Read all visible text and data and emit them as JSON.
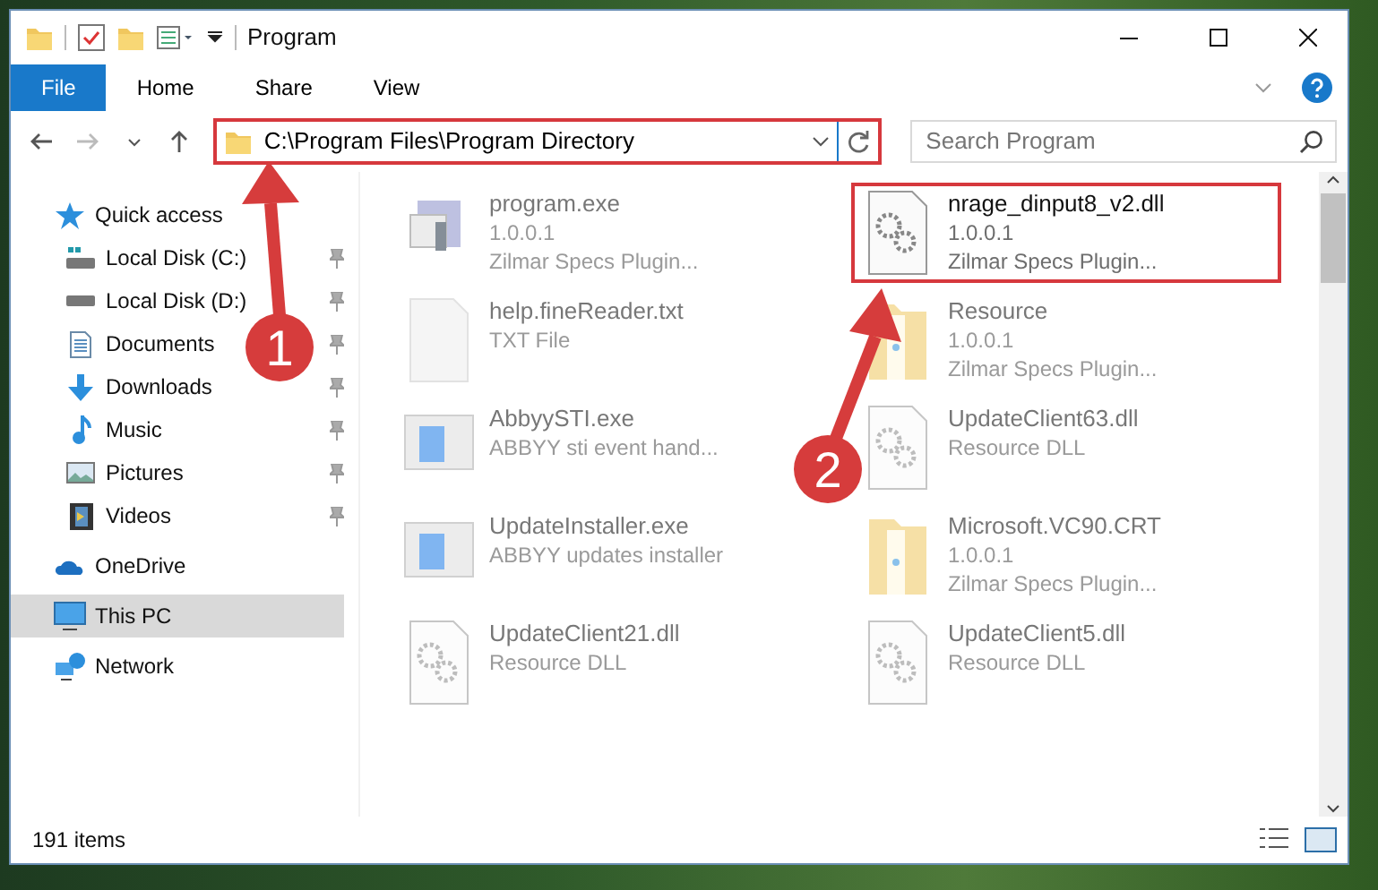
{
  "window": {
    "title": "Program"
  },
  "ribbon_tabs": [
    {
      "label": "File",
      "selected": true
    },
    {
      "label": "Home",
      "selected": false
    },
    {
      "label": "Share",
      "selected": false
    },
    {
      "label": "View",
      "selected": false
    }
  ],
  "address": {
    "value": "C:\\Program Files\\Program Directory",
    "highlighted": true
  },
  "search": {
    "placeholder": "Search Program"
  },
  "nav": [
    {
      "label": "Quick access",
      "kind": "group",
      "pinned": false,
      "selected": false
    },
    {
      "label": "Local Disk (C:)",
      "kind": "item",
      "pinned": true,
      "selected": false
    },
    {
      "label": "Local Disk (D:)",
      "kind": "item",
      "pinned": true,
      "selected": false
    },
    {
      "label": "Documents",
      "kind": "item",
      "pinned": true,
      "selected": false
    },
    {
      "label": "Downloads",
      "kind": "item",
      "pinned": true,
      "selected": false
    },
    {
      "label": "Music",
      "kind": "item",
      "pinned": true,
      "selected": false
    },
    {
      "label": "Pictures",
      "kind": "item",
      "pinned": true,
      "selected": false
    },
    {
      "label": "Videos",
      "kind": "item",
      "pinned": true,
      "selected": false
    },
    {
      "label": "OneDrive",
      "kind": "group",
      "pinned": false,
      "selected": false
    },
    {
      "label": "This PC",
      "kind": "group",
      "pinned": false,
      "selected": true
    },
    {
      "label": "Network",
      "kind": "group",
      "pinned": false,
      "selected": false
    }
  ],
  "files": [
    {
      "name": "program.exe",
      "kind": "exe",
      "blurred": true,
      "highlighted": false,
      "details": [
        "1.0.0.1",
        "Zilmar Specs Plugin..."
      ]
    },
    {
      "name": "nrage_dinput8_v2.dll",
      "kind": "dll",
      "blurred": false,
      "highlighted": true,
      "details": [
        "1.0.0.1",
        "Zilmar Specs Plugin..."
      ]
    },
    {
      "name": "help.fineReader.txt",
      "kind": "txt",
      "blurred": true,
      "highlighted": false,
      "details": [
        "TXT File"
      ]
    },
    {
      "name": "Resource",
      "kind": "folder",
      "blurred": true,
      "highlighted": false,
      "details": [
        "1.0.0.1",
        "Zilmar Specs Plugin..."
      ]
    },
    {
      "name": "AbbyySTI.exe",
      "kind": "app",
      "blurred": true,
      "highlighted": false,
      "details": [
        "ABBYY sti event hand..."
      ]
    },
    {
      "name": "UpdateClient63.dll",
      "kind": "dll",
      "blurred": true,
      "highlighted": false,
      "details": [
        "Resource DLL"
      ]
    },
    {
      "name": "UpdateInstaller.exe",
      "kind": "app",
      "blurred": true,
      "highlighted": false,
      "details": [
        "ABBYY updates installer"
      ]
    },
    {
      "name": "Microsoft.VC90.CRT",
      "kind": "folder",
      "blurred": true,
      "highlighted": false,
      "details": [
        "1.0.0.1",
        "Zilmar Specs Plugin..."
      ]
    },
    {
      "name": "UpdateClient21.dll",
      "kind": "dll",
      "blurred": true,
      "highlighted": false,
      "details": [
        "Resource DLL"
      ]
    },
    {
      "name": "UpdateClient5.dll",
      "kind": "dll",
      "blurred": true,
      "highlighted": false,
      "details": [
        "Resource DLL"
      ]
    }
  ],
  "status_bar": {
    "item_count": "191 items"
  },
  "callouts": [
    {
      "number": "1"
    },
    {
      "number": "2"
    }
  ]
}
